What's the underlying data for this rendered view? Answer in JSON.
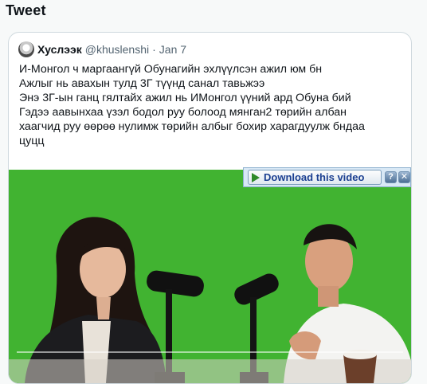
{
  "page": {
    "heading": "Tweet"
  },
  "tweet": {
    "author": "Хуслээк",
    "handle": "@khuslenshi",
    "separator": "·",
    "date": "Jan 7",
    "lines": [
      "И-Монгол ч маргаангүй Обунагийн эхлүүлсэн ажил юм бн",
      "Ажлыг нь авахын тулд 3Г түүнд санал тавьжээ",
      "Энэ 3Г-ын ганц гялтайх ажил нь ИМонгол үүний ард Обуна бий",
      "Гэдээ аавынхаа үзэл бодол руу болоод мянган2 төрийн албан",
      "хаагчид руу өөрөө нулимж төрийн албыг бохир харагдуулж бндаа",
      "цуцц"
    ]
  },
  "video": {
    "background_color": "#42b832",
    "progress_fraction": 0.0
  },
  "download_bar": {
    "label": "Download this video",
    "help_symbol": "?",
    "close_symbol": "✕"
  },
  "icons": {
    "avatar": "user-avatar",
    "download": "play-arrow-icon",
    "help": "help-icon",
    "close": "close-icon"
  }
}
